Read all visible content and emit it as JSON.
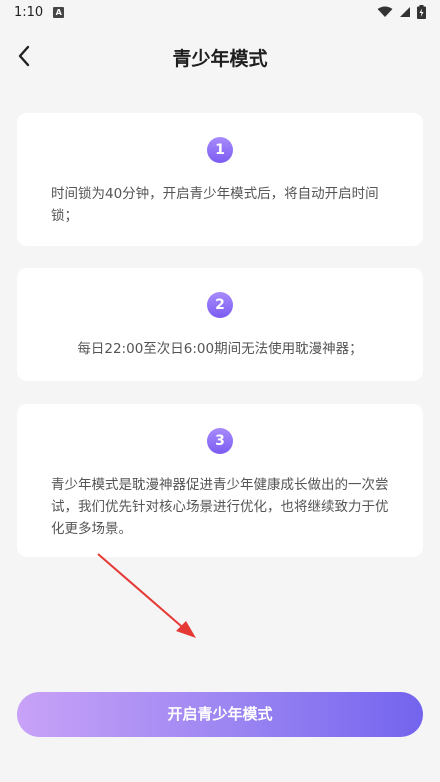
{
  "status_bar": {
    "time": "1:10",
    "notification_icon": "a-letter-icon",
    "wifi_icon": "wifi-icon",
    "signal_icon": "signal-icon",
    "battery_icon": "battery-charging-icon"
  },
  "header": {
    "back_icon": "chevron-left-icon",
    "title": "青少年模式"
  },
  "cards": [
    {
      "number": "1",
      "text": "时间锁为40分钟，开启青少年模式后，将自动开启时间锁；"
    },
    {
      "number": "2",
      "text": "每日22:00至次日6:00期间无法使用耽漫神器；"
    },
    {
      "number": "3",
      "text": "青少年模式是耽漫神器促进青少年健康成长做出的一次尝试，我们优先针对核心场景进行优化，也将继续致力于优化更多场景。"
    }
  ],
  "annotation": {
    "arrow_icon": "red-arrow-icon",
    "color": "#e53935"
  },
  "actions": {
    "enable_label": "开启青少年模式"
  },
  "colors": {
    "accent_start": "#c8a2f7",
    "accent_end": "#7364ee",
    "badge": "#8b6cf4",
    "background": "#f5f5f6"
  }
}
